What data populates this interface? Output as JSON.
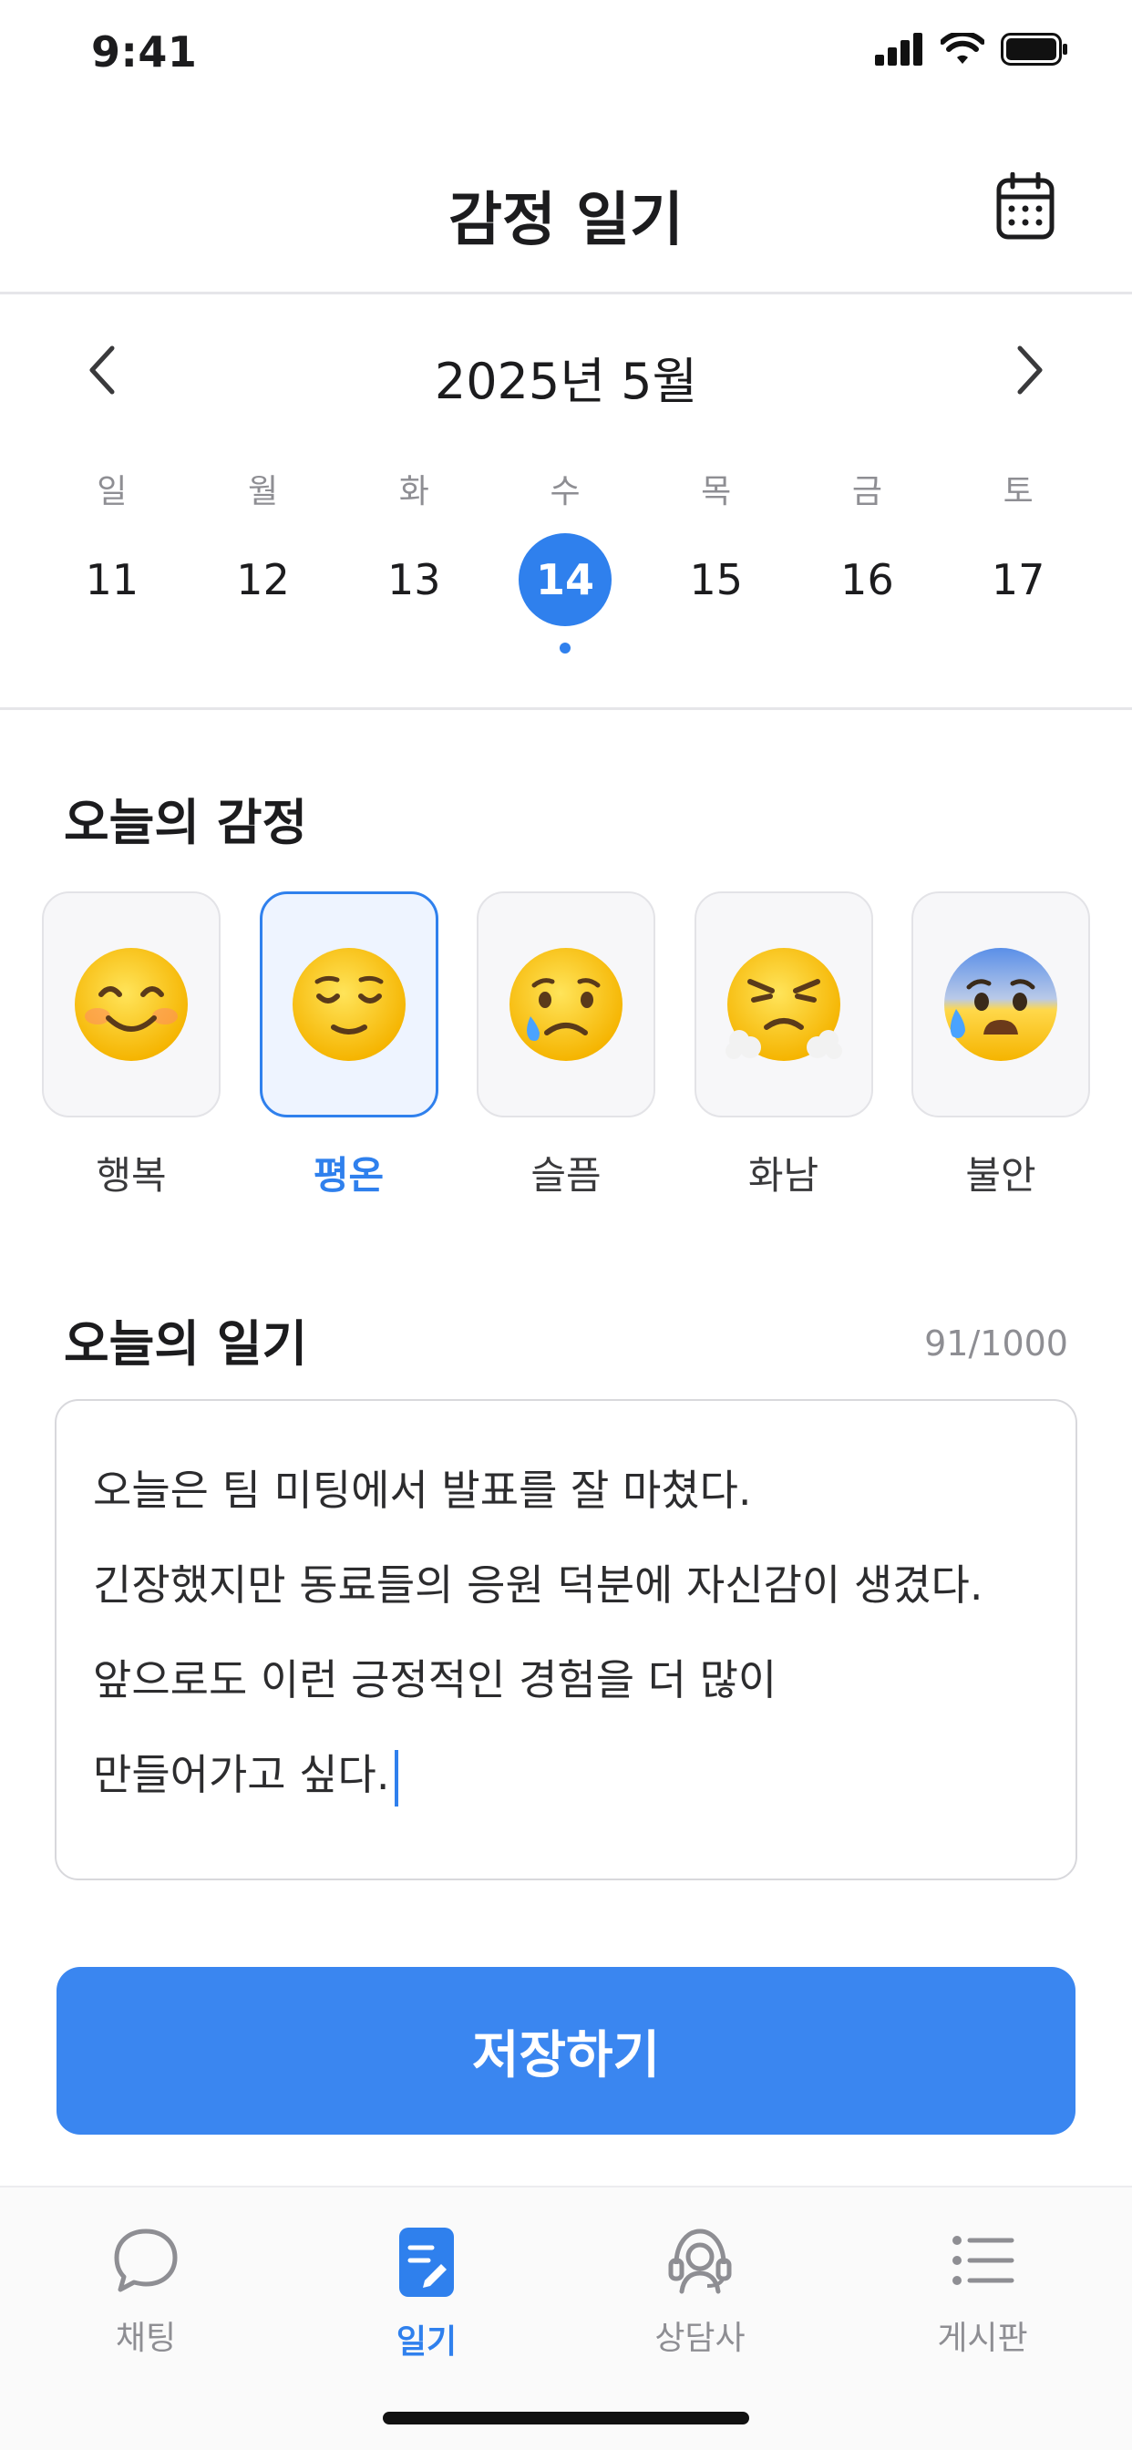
{
  "status_bar": {
    "time": "9:41"
  },
  "header": {
    "title": "감정 일기",
    "calendar_icon": "calendar-icon"
  },
  "calendar": {
    "month_label": "2025년 5월",
    "prev_icon": "chevron-left-icon",
    "next_icon": "chevron-right-icon",
    "weekdays": [
      "일",
      "월",
      "화",
      "수",
      "목",
      "금",
      "토"
    ],
    "dates": [
      "11",
      "12",
      "13",
      "14",
      "15",
      "16",
      "17"
    ],
    "selected_date": "14"
  },
  "emotion": {
    "title": "오늘의 감정",
    "selected": "평온",
    "items": [
      {
        "label": "행복",
        "emoji": "😊"
      },
      {
        "label": "평온",
        "emoji": "😌"
      },
      {
        "label": "슬픔",
        "emoji": "😢"
      },
      {
        "label": "화남",
        "emoji": "😤"
      },
      {
        "label": "불안",
        "emoji": "😰"
      }
    ]
  },
  "diary": {
    "title": "오늘의 일기",
    "count": "91/1000",
    "lines": [
      "오늘은 팀 미팅에서 발표를 잘 마쳤다.",
      "긴장했지만 동료들의 응원 덕분에 자신감이 생겼다.",
      "앞으로도 이런 긍정적인 경험을 더 많이",
      "만들어가고 싶다."
    ]
  },
  "save_label": "저장하기",
  "tabs": [
    {
      "label": "채팅",
      "icon": "chat-bubble-icon"
    },
    {
      "label": "일기",
      "icon": "diary-icon"
    },
    {
      "label": "상담사",
      "icon": "counselor-headset-icon"
    },
    {
      "label": "게시판",
      "icon": "list-icon"
    }
  ],
  "active_tab": "일기",
  "colors": {
    "accent": "#2f80ed",
    "button": "#3a86f0"
  }
}
